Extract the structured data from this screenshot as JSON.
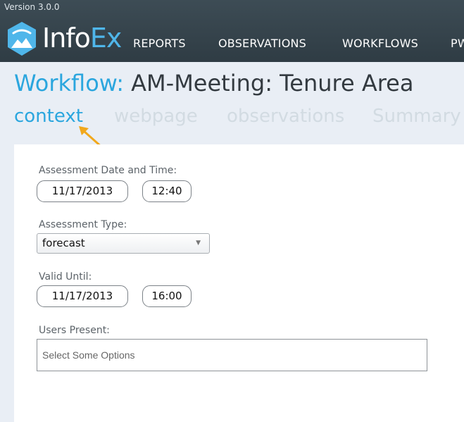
{
  "header": {
    "version": "Version 3.0.0",
    "brand_part1": "Info",
    "brand_part2": "Ex",
    "nav": [
      "REPORTS",
      "OBSERVATIONS",
      "WORKFLOWS",
      "PW"
    ]
  },
  "page": {
    "title_label": "Workflow:",
    "title_value": "AM-Meeting: Tenure Area"
  },
  "tabs": [
    "context",
    "webpage",
    "observations",
    "Summary"
  ],
  "form": {
    "assessment_label": "Assessment Date and Time:",
    "assessment_date": "11/17/2013",
    "assessment_time": "12:40",
    "type_label": "Assessment Type:",
    "type_value": "forecast",
    "valid_label": "Valid Until:",
    "valid_date": "11/17/2013",
    "valid_time": "16:00",
    "users_label": "Users Present:",
    "users_placeholder": "Select Some Options"
  },
  "colors": {
    "accent": "#2ba6de",
    "header_bg": "#34424a",
    "arrow": "#f1a81c"
  },
  "icons": {
    "logo": "mountain-shield-logo",
    "select_caret": "triangle-down",
    "arrow": "pointer-arrow"
  }
}
